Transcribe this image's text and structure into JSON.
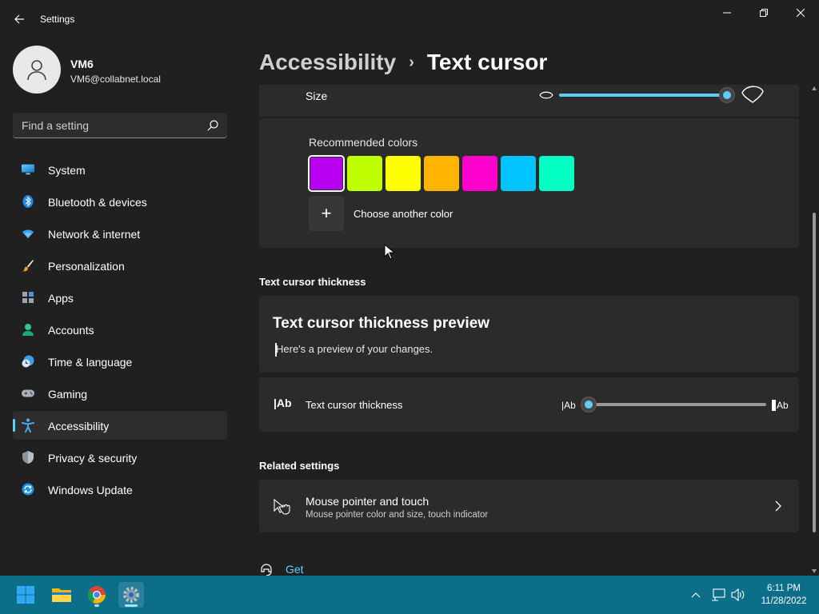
{
  "window": {
    "title": "Settings"
  },
  "user": {
    "name": "VM6",
    "email": "VM6@collabnet.local"
  },
  "search": {
    "placeholder": "Find a setting"
  },
  "sidebar": {
    "items": [
      {
        "label": "System",
        "icon": "system-icon"
      },
      {
        "label": "Bluetooth & devices",
        "icon": "bluetooth-icon"
      },
      {
        "label": "Network & internet",
        "icon": "wifi-icon"
      },
      {
        "label": "Personalization",
        "icon": "brush-icon"
      },
      {
        "label": "Apps",
        "icon": "apps-icon"
      },
      {
        "label": "Accounts",
        "icon": "accounts-icon"
      },
      {
        "label": "Time & language",
        "icon": "clock-globe-icon"
      },
      {
        "label": "Gaming",
        "icon": "gamepad-icon"
      },
      {
        "label": "Accessibility",
        "icon": "accessibility-icon",
        "active": true
      },
      {
        "label": "Privacy & security",
        "icon": "shield-icon"
      },
      {
        "label": "Windows Update",
        "icon": "update-icon"
      }
    ]
  },
  "breadcrumb": {
    "parent": "Accessibility",
    "separator": "›",
    "current": "Text cursor"
  },
  "indicator": {
    "size_label": "Size",
    "size_level": 1.0,
    "recommended_label": "Recommended colors",
    "colors": [
      "#b800f0",
      "#c0ff00",
      "#ffff00",
      "#ffb400",
      "#ff00cc",
      "#00c3ff",
      "#00ffc0"
    ],
    "selected_color_index": 0,
    "add_symbol": "+",
    "choose_another_label": "Choose another color"
  },
  "thickness": {
    "section_title": "Text cursor thickness",
    "preview_title": "Text cursor thickness preview",
    "preview_text": "Here's a preview of your changes.",
    "row_icon_text": "|Ab",
    "row_label": "Text cursor thickness",
    "min_label": "|Ab",
    "max_label": "Ab",
    "level": 0.0
  },
  "related": {
    "section_title": "Related settings",
    "items": [
      {
        "title": "Mouse pointer and touch",
        "subtitle": "Mouse pointer color and size, touch indicator"
      }
    ]
  },
  "help": {
    "label": "Get help"
  },
  "taskbar": {
    "apps": [
      "start-icon",
      "file-explorer-icon",
      "chrome-icon",
      "settings-icon"
    ],
    "time": "6:11 PM",
    "date": "11/28/2022"
  },
  "colors": {
    "accent": "#60cdff",
    "background": "#202020",
    "card": "#2b2b2b",
    "taskbar": "#0c6f8a"
  }
}
